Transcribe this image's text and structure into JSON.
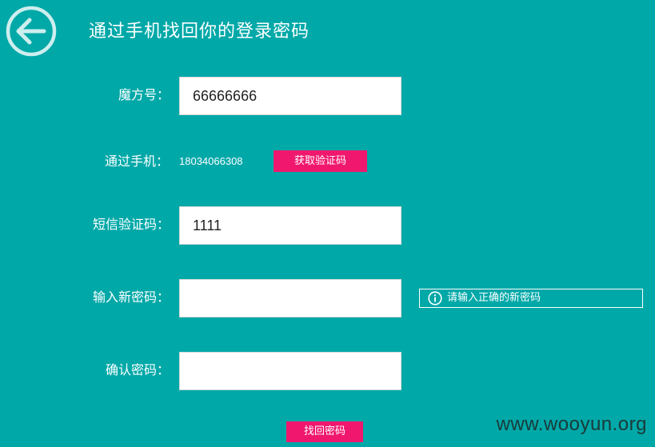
{
  "header": {
    "back_icon": "arrow-left-circle-icon",
    "title": "通过手机找回你的登录密码"
  },
  "form": {
    "mofang_label": "魔方号：",
    "mofang_value": "66666666",
    "phone_label": "通过手机：",
    "phone_number": "18034066308",
    "get_code_button": "获取验证码",
    "sms_code_label": "短信验证码：",
    "sms_code_value": "1111",
    "new_password_label": "输入新密码：",
    "new_password_value": "",
    "new_password_hint_icon": "info-icon",
    "new_password_hint": "请输入正确的新密码",
    "confirm_password_label": "确认密码：",
    "confirm_password_value": "",
    "submit_button": "找回密码"
  },
  "watermark": "www.wooyun.org",
  "colors": {
    "background": "#00a8a8",
    "button": "#f0186e",
    "text": "#ffffff"
  }
}
